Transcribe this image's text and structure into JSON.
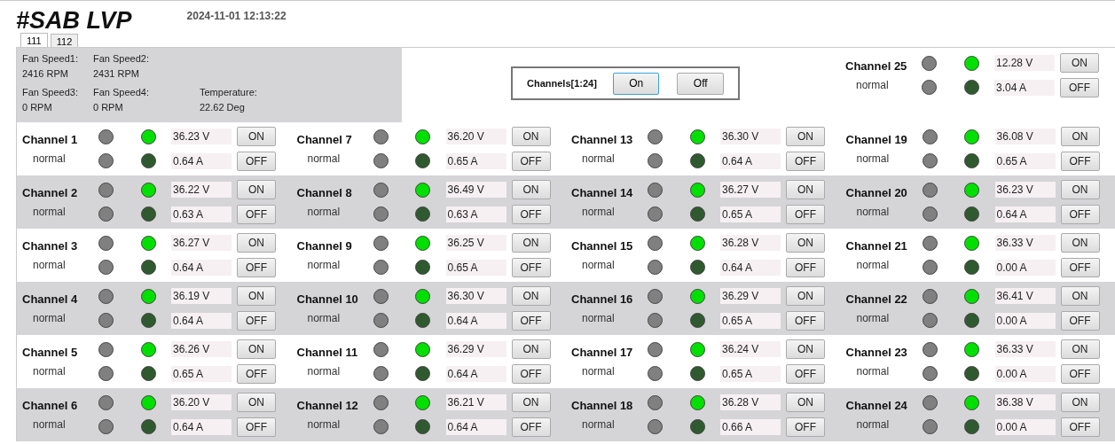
{
  "title": "#SAB LVP",
  "timestamp": "2024-11-01 12:13:22",
  "tabs": [
    {
      "label": "111",
      "selected": true
    },
    {
      "label": "112",
      "selected": false
    }
  ],
  "fans": [
    {
      "label": "Fan Speed1:",
      "value": "2416 RPM"
    },
    {
      "label": "Fan Speed2:",
      "value": "2431 RPM"
    },
    {
      "label": "Fan Speed3:",
      "value": "0 RPM"
    },
    {
      "label": "Fan Speed4:",
      "value": "0 RPM"
    },
    {
      "label": "Temperature:",
      "value": "22.62 Deg"
    }
  ],
  "group_control": {
    "label": "Channels[1:24]",
    "on_button": "On",
    "off_button": "Off"
  },
  "extra_channel": {
    "name": "Channel 25",
    "status": "normal",
    "leds": [
      {
        "color": "#808080"
      },
      {
        "color": "#00e000"
      },
      {
        "color": "#808080"
      },
      {
        "color": "#2f5a2f"
      }
    ],
    "voltage": "12.28 V",
    "current": "3.04 A",
    "on_button": "ON",
    "off_button": "OFF"
  },
  "channels": [
    {
      "name": "Channel 1",
      "status": "normal",
      "leds": [
        {
          "color": "#808080"
        },
        {
          "color": "#00e000"
        },
        {
          "color": "#808080"
        },
        {
          "color": "#2f5a2f"
        }
      ],
      "voltage": "36.23 V",
      "current": "0.64 A",
      "on_button": "ON",
      "off_button": "OFF"
    },
    {
      "name": "Channel 2",
      "status": "normal",
      "leds": [
        {
          "color": "#808080"
        },
        {
          "color": "#00e000"
        },
        {
          "color": "#808080"
        },
        {
          "color": "#2f5a2f"
        }
      ],
      "voltage": "36.22 V",
      "current": "0.63 A",
      "on_button": "ON",
      "off_button": "OFF"
    },
    {
      "name": "Channel 3",
      "status": "normal",
      "leds": [
        {
          "color": "#808080"
        },
        {
          "color": "#00e000"
        },
        {
          "color": "#808080"
        },
        {
          "color": "#2f5a2f"
        }
      ],
      "voltage": "36.27 V",
      "current": "0.64 A",
      "on_button": "ON",
      "off_button": "OFF"
    },
    {
      "name": "Channel 4",
      "status": "normal",
      "leds": [
        {
          "color": "#808080"
        },
        {
          "color": "#00e000"
        },
        {
          "color": "#808080"
        },
        {
          "color": "#2f5a2f"
        }
      ],
      "voltage": "36.19 V",
      "current": "0.64 A",
      "on_button": "ON",
      "off_button": "OFF"
    },
    {
      "name": "Channel 5",
      "status": "normal",
      "leds": [
        {
          "color": "#808080"
        },
        {
          "color": "#00e000"
        },
        {
          "color": "#808080"
        },
        {
          "color": "#2f5a2f"
        }
      ],
      "voltage": "36.26 V",
      "current": "0.65 A",
      "on_button": "ON",
      "off_button": "OFF"
    },
    {
      "name": "Channel 6",
      "status": "normal",
      "leds": [
        {
          "color": "#808080"
        },
        {
          "color": "#00e000"
        },
        {
          "color": "#808080"
        },
        {
          "color": "#2f5a2f"
        }
      ],
      "voltage": "36.20 V",
      "current": "0.64 A",
      "on_button": "ON",
      "off_button": "OFF"
    },
    {
      "name": "Channel 7",
      "status": "normal",
      "leds": [
        {
          "color": "#808080"
        },
        {
          "color": "#00e000"
        },
        {
          "color": "#808080"
        },
        {
          "color": "#2f5a2f"
        }
      ],
      "voltage": "36.20 V",
      "current": "0.65 A",
      "on_button": "ON",
      "off_button": "OFF"
    },
    {
      "name": "Channel 8",
      "status": "normal",
      "leds": [
        {
          "color": "#808080"
        },
        {
          "color": "#00e000"
        },
        {
          "color": "#808080"
        },
        {
          "color": "#2f5a2f"
        }
      ],
      "voltage": "36.49 V",
      "current": "0.63 A",
      "on_button": "ON",
      "off_button": "OFF"
    },
    {
      "name": "Channel 9",
      "status": "normal",
      "leds": [
        {
          "color": "#808080"
        },
        {
          "color": "#00e000"
        },
        {
          "color": "#808080"
        },
        {
          "color": "#2f5a2f"
        }
      ],
      "voltage": "36.25 V",
      "current": "0.65 A",
      "on_button": "ON",
      "off_button": "OFF"
    },
    {
      "name": "Channel 10",
      "status": "normal",
      "leds": [
        {
          "color": "#808080"
        },
        {
          "color": "#00e000"
        },
        {
          "color": "#808080"
        },
        {
          "color": "#2f5a2f"
        }
      ],
      "voltage": "36.30 V",
      "current": "0.64 A",
      "on_button": "ON",
      "off_button": "OFF"
    },
    {
      "name": "Channel 11",
      "status": "normal",
      "leds": [
        {
          "color": "#808080"
        },
        {
          "color": "#00e000"
        },
        {
          "color": "#808080"
        },
        {
          "color": "#2f5a2f"
        }
      ],
      "voltage": "36.29 V",
      "current": "0.64 A",
      "on_button": "ON",
      "off_button": "OFF"
    },
    {
      "name": "Channel 12",
      "status": "normal",
      "leds": [
        {
          "color": "#808080"
        },
        {
          "color": "#00e000"
        },
        {
          "color": "#808080"
        },
        {
          "color": "#2f5a2f"
        }
      ],
      "voltage": "36.21 V",
      "current": "0.64 A",
      "on_button": "ON",
      "off_button": "OFF"
    },
    {
      "name": "Channel 13",
      "status": "normal",
      "leds": [
        {
          "color": "#808080"
        },
        {
          "color": "#00e000"
        },
        {
          "color": "#808080"
        },
        {
          "color": "#2f5a2f"
        }
      ],
      "voltage": "36.30 V",
      "current": "0.64 A",
      "on_button": "ON",
      "off_button": "OFF"
    },
    {
      "name": "Channel 14",
      "status": "normal",
      "leds": [
        {
          "color": "#808080"
        },
        {
          "color": "#00e000"
        },
        {
          "color": "#808080"
        },
        {
          "color": "#2f5a2f"
        }
      ],
      "voltage": "36.27 V",
      "current": "0.65 A",
      "on_button": "ON",
      "off_button": "OFF"
    },
    {
      "name": "Channel 15",
      "status": "normal",
      "leds": [
        {
          "color": "#808080"
        },
        {
          "color": "#00e000"
        },
        {
          "color": "#808080"
        },
        {
          "color": "#2f5a2f"
        }
      ],
      "voltage": "36.28 V",
      "current": "0.64 A",
      "on_button": "ON",
      "off_button": "OFF"
    },
    {
      "name": "Channel 16",
      "status": "normal",
      "leds": [
        {
          "color": "#808080"
        },
        {
          "color": "#00e000"
        },
        {
          "color": "#808080"
        },
        {
          "color": "#2f5a2f"
        }
      ],
      "voltage": "36.29 V",
      "current": "0.65 A",
      "on_button": "ON",
      "off_button": "OFF"
    },
    {
      "name": "Channel 17",
      "status": "normal",
      "leds": [
        {
          "color": "#808080"
        },
        {
          "color": "#00e000"
        },
        {
          "color": "#808080"
        },
        {
          "color": "#2f5a2f"
        }
      ],
      "voltage": "36.24 V",
      "current": "0.65 A",
      "on_button": "ON",
      "off_button": "OFF"
    },
    {
      "name": "Channel 18",
      "status": "normal",
      "leds": [
        {
          "color": "#808080"
        },
        {
          "color": "#00e000"
        },
        {
          "color": "#808080"
        },
        {
          "color": "#2f5a2f"
        }
      ],
      "voltage": "36.28 V",
      "current": "0.66 A",
      "on_button": "ON",
      "off_button": "OFF"
    },
    {
      "name": "Channel 19",
      "status": "normal",
      "leds": [
        {
          "color": "#808080"
        },
        {
          "color": "#00e000"
        },
        {
          "color": "#808080"
        },
        {
          "color": "#2f5a2f"
        }
      ],
      "voltage": "36.08 V",
      "current": "0.65 A",
      "on_button": "ON",
      "off_button": "OFF"
    },
    {
      "name": "Channel 20",
      "status": "normal",
      "leds": [
        {
          "color": "#808080"
        },
        {
          "color": "#00e000"
        },
        {
          "color": "#808080"
        },
        {
          "color": "#2f5a2f"
        }
      ],
      "voltage": "36.23 V",
      "current": "0.64 A",
      "on_button": "ON",
      "off_button": "OFF"
    },
    {
      "name": "Channel 21",
      "status": "normal",
      "leds": [
        {
          "color": "#808080"
        },
        {
          "color": "#00e000"
        },
        {
          "color": "#808080"
        },
        {
          "color": "#2f5a2f"
        }
      ],
      "voltage": "36.33 V",
      "current": "0.00 A",
      "on_button": "ON",
      "off_button": "OFF"
    },
    {
      "name": "Channel 22",
      "status": "normal",
      "leds": [
        {
          "color": "#808080"
        },
        {
          "color": "#00e000"
        },
        {
          "color": "#808080"
        },
        {
          "color": "#2f5a2f"
        }
      ],
      "voltage": "36.41 V",
      "current": "0.00 A",
      "on_button": "ON",
      "off_button": "OFF"
    },
    {
      "name": "Channel 23",
      "status": "normal",
      "leds": [
        {
          "color": "#808080"
        },
        {
          "color": "#00e000"
        },
        {
          "color": "#808080"
        },
        {
          "color": "#2f5a2f"
        }
      ],
      "voltage": "36.33 V",
      "current": "0.00 A",
      "on_button": "ON",
      "off_button": "OFF"
    },
    {
      "name": "Channel 24",
      "status": "normal",
      "leds": [
        {
          "color": "#808080"
        },
        {
          "color": "#00e000"
        },
        {
          "color": "#808080"
        },
        {
          "color": "#2f5a2f"
        }
      ],
      "voltage": "36.38 V",
      "current": "0.00 A",
      "on_button": "ON",
      "off_button": "OFF"
    }
  ]
}
